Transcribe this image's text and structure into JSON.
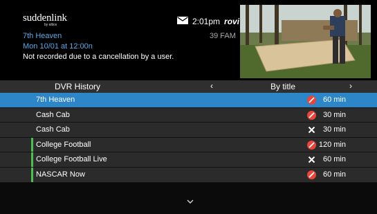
{
  "brand": {
    "name": "suddenlink",
    "sub": "by altice"
  },
  "header": {
    "time": "2:01pm",
    "provider": "rovi"
  },
  "program": {
    "title": "7th Heaven",
    "date": "Mon 10/01 at 12:00n",
    "status": "Not recorded due to a cancellation by a user.",
    "channel": "39 FAM"
  },
  "list_header": {
    "label": "DVR History",
    "left_arrow": "‹",
    "sort": "By title",
    "right_arrow": "›"
  },
  "rows": [
    {
      "title": "7th Heaven",
      "status_icon": "cancelled-icon",
      "duration": "60 min",
      "selected": true,
      "marked": false
    },
    {
      "title": "Cash Cab",
      "status_icon": "cancelled-icon",
      "duration": "30 min",
      "selected": false,
      "marked": false
    },
    {
      "title": "Cash Cab",
      "status_icon": "failed-icon",
      "duration": "30 min",
      "selected": false,
      "marked": false
    },
    {
      "title": "College Football",
      "status_icon": "cancelled-icon",
      "duration": "120 min",
      "selected": false,
      "marked": true
    },
    {
      "title": "College Football Live",
      "status_icon": "failed-icon",
      "duration": "60 min",
      "selected": false,
      "marked": true
    },
    {
      "title": "NASCAR Now",
      "status_icon": "cancelled-icon",
      "duration": "60 min",
      "selected": false,
      "marked": true
    }
  ],
  "colors": {
    "selected": "#2d86c8",
    "accent_text": "#5aa9e6",
    "marker": "#4fbf52",
    "cancel": "#e8453c"
  }
}
